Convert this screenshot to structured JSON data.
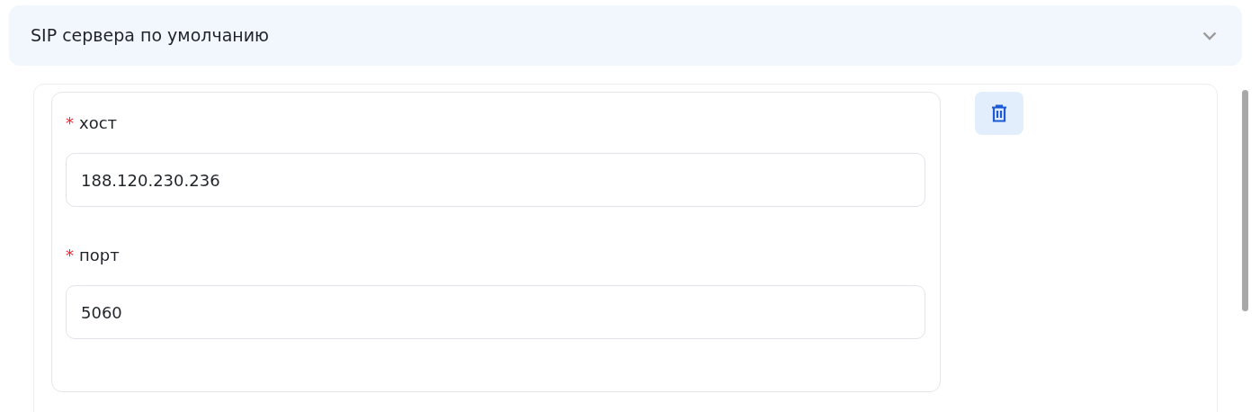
{
  "section": {
    "title": "SIP сервера по умолчанию"
  },
  "server": {
    "fields": [
      {
        "required_mark": "*",
        "label": "хост",
        "value": "188.120.230.236"
      },
      {
        "required_mark": "*",
        "label": "порт",
        "value": "5060"
      }
    ]
  }
}
